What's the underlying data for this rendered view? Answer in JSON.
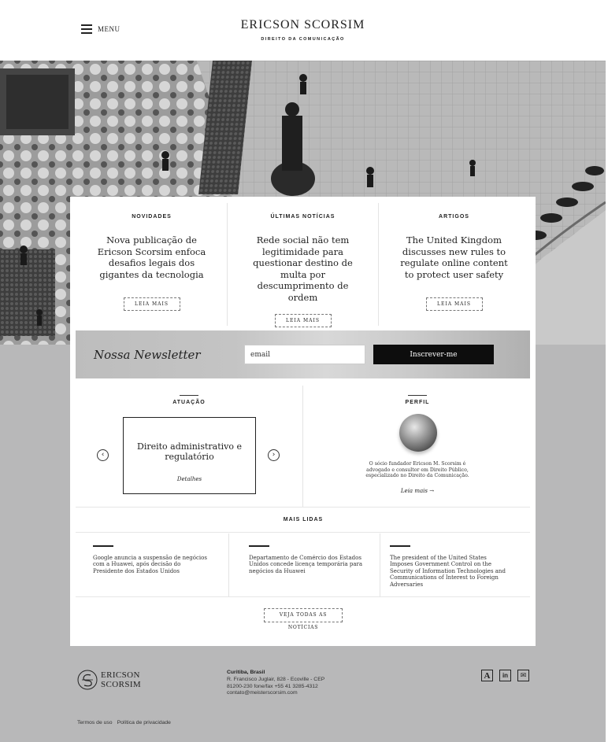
{
  "header": {
    "menu_label": "MENU",
    "brand_name": "ERICSON SCORSIM",
    "brand_subtitle": "DIREITO DA COMUNICAÇÃO"
  },
  "news": [
    {
      "category": "NOVIDADES",
      "title": "Nova publicação de Ericson Scorsim enfoca desafios legais dos gigantes da tecnologia",
      "button": "LEIA MAIS"
    },
    {
      "category": "ÚLTIMAS NOTÍCIAS",
      "title": "Rede social não tem legitimidade para questionar destino de multa por descumprimento de ordem",
      "button": "LEIA MAIS"
    },
    {
      "category": "ARTIGOS",
      "title": "The United Kingdom discusses new rules to regulate online content to protect user safety",
      "button": "LEIA MAIS"
    }
  ],
  "newsletter": {
    "title": "Nossa Newsletter",
    "input_value": "email",
    "button": "Inscrever-me"
  },
  "atuacao": {
    "heading": "ATUAÇÃO",
    "item_title": "Direito administrativo e regulatório",
    "details": "Detalhes",
    "prev": "‹",
    "next": "›"
  },
  "perfil": {
    "heading": "PERFIL",
    "text": "O sócio fundador Ericson M. Scorsim é advogado e consultor em Direito Público, especializado no Direito da Comunicação.",
    "link": "Leia mais →"
  },
  "mais_lidas": {
    "heading": "MAIS LIDAS",
    "items": [
      "Google anuncia a suspensão de negócios com a Huawei, após decisão do Presidente dos Estados Unidos",
      "Departamento de Comércio dos Estados Unidos concede licença temporária para negócios da Huawei",
      "The president of the United States Imposes Government Control on the Security of Information Technologies and Communications of Interest to Foreign Adversaries"
    ],
    "all_button": "VEJA TODAS AS NOTÍCIAS"
  },
  "footer": {
    "logo_line1": "ERICSON",
    "logo_line2": "SCORSIM",
    "city": "Curitiba, Brasil",
    "address_1": "R. Francisco Juglair, 828 - Ecoville - CEP",
    "address_2": "81200-230 fone/fax +55 41 3285-4312",
    "email": "contato@meisterscorsim.com",
    "social": [
      "A",
      "in",
      "✉"
    ],
    "terms": "Termos de uso",
    "privacy": "Política de privacidade"
  }
}
